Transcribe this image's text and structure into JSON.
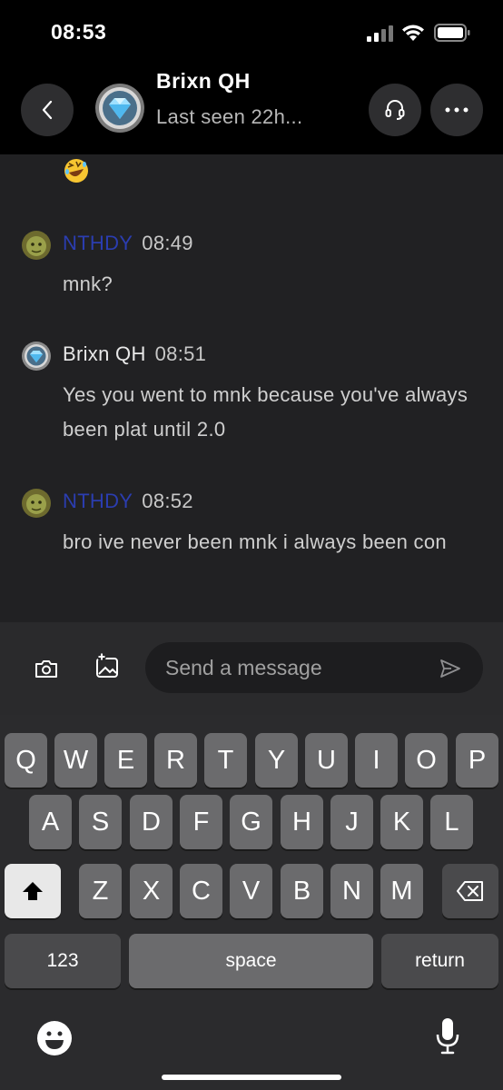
{
  "status_bar": {
    "time": "08:53"
  },
  "header": {
    "title": "Brixn QH",
    "subtitle": "Last seen 22h..."
  },
  "messages": [
    {
      "author": "NTHDY",
      "time": "08:49",
      "text": "mnk?",
      "author_color": "#2b3db0"
    },
    {
      "author": "Brixn QH",
      "time": "08:51",
      "text": "Yes you went to mnk because you've always been plat until 2.0",
      "author_color": "#e8e8e8"
    },
    {
      "author": "NTHDY",
      "time": "08:52",
      "text": "bro ive never been mnk i always been con",
      "author_color": "#2b3db0"
    }
  ],
  "composer": {
    "placeholder": "Send a message"
  },
  "keyboard": {
    "row1": [
      "Q",
      "W",
      "E",
      "R",
      "T",
      "Y",
      "U",
      "I",
      "O",
      "P"
    ],
    "row2": [
      "A",
      "S",
      "D",
      "F",
      "G",
      "H",
      "J",
      "K",
      "L"
    ],
    "row3": [
      "Z",
      "X",
      "C",
      "V",
      "B",
      "N",
      "M"
    ],
    "numbers_label": "123",
    "space_label": "space",
    "return_label": "return"
  },
  "colors": {
    "background": "#000000",
    "chat_background": "#212123",
    "nthdy_name": "#2b3db0",
    "key_background": "#6b6b6d"
  },
  "icons": [
    "signal-icon",
    "wifi-icon",
    "battery-icon",
    "back-chevron-icon",
    "diamond-avatar-icon",
    "headset-icon",
    "more-dots-icon",
    "laughing-emoji-icon",
    "shrek-avatar-icon",
    "camera-icon",
    "add-image-icon",
    "send-icon",
    "shift-icon",
    "backspace-icon",
    "emoji-icon",
    "microphone-icon"
  ]
}
